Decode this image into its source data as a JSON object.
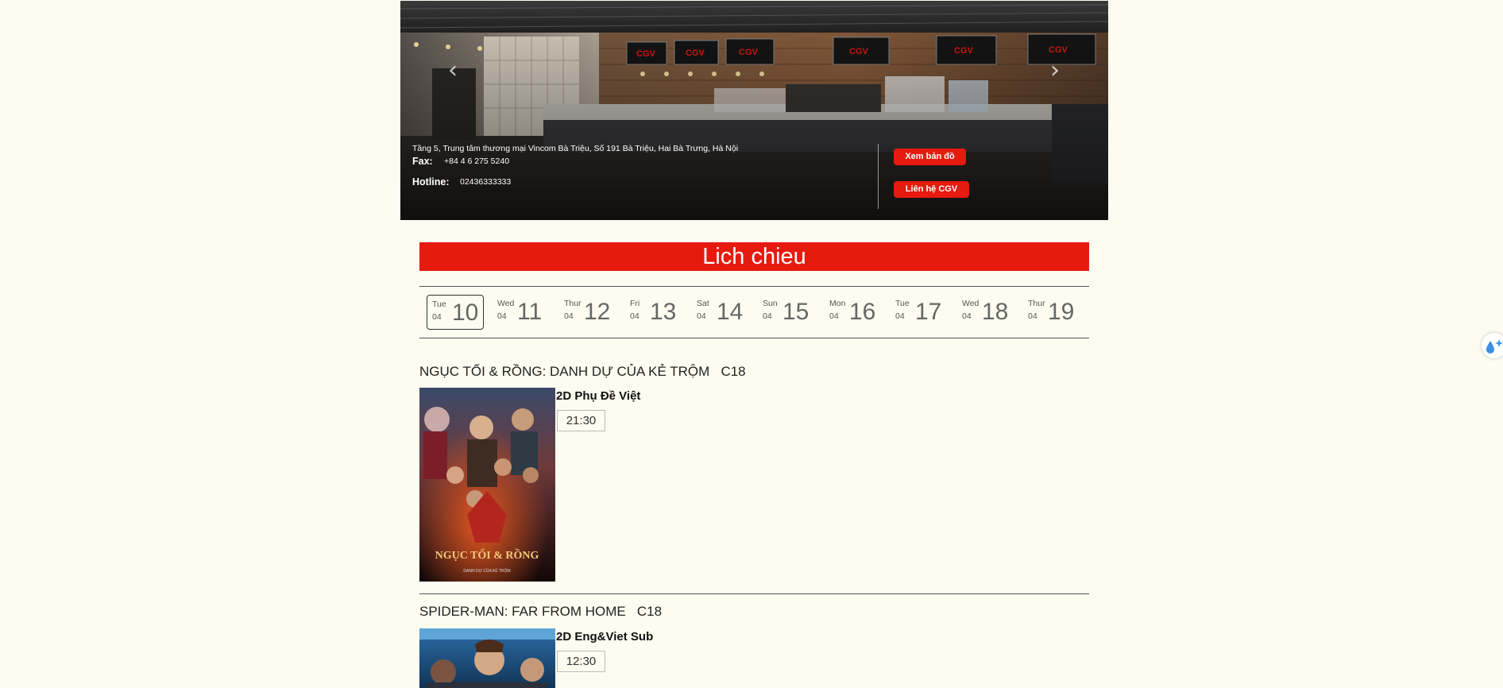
{
  "banner": {
    "address": "Tầng 5, Trung tâm thương mại Vincom Bà Triệu, Số 191 Bà Triệu, Hai Bà Trưng, Hà Nội",
    "fax_label": "Fax:",
    "fax_value": "+84 4 6 275 5240",
    "hotline_label": "Hotline:",
    "hotline_value": "02436333333",
    "map_button": "Xem bản đồ",
    "contact_button": "Liên hệ CGV",
    "prev_icon": "chevron-left-icon",
    "next_icon": "chevron-right-icon",
    "accent": "#e71a0f"
  },
  "schedule_title": "Lich chieu",
  "dates": [
    {
      "weekday": "Tue",
      "month": "04",
      "day": "10",
      "active": true
    },
    {
      "weekday": "Wed",
      "month": "04",
      "day": "11"
    },
    {
      "weekday": "Thur",
      "month": "04",
      "day": "12"
    },
    {
      "weekday": "Fri",
      "month": "04",
      "day": "13"
    },
    {
      "weekday": "Sat",
      "month": "04",
      "day": "14"
    },
    {
      "weekday": "Sun",
      "month": "04",
      "day": "15"
    },
    {
      "weekday": "Mon",
      "month": "04",
      "day": "16"
    },
    {
      "weekday": "Tue",
      "month": "04",
      "day": "17"
    },
    {
      "weekday": "Wed",
      "month": "04",
      "day": "18"
    },
    {
      "weekday": "Thur",
      "month": "04",
      "day": "19"
    }
  ],
  "movies": [
    {
      "title": "NGỤC TỐI & RỒNG: DANH DỰ CỦA KẺ TRỘM",
      "rating": "C18",
      "format": "2D Phụ Đề Việt",
      "times": [
        "21:30"
      ],
      "poster_text": "NGỤC TỐI & RỒNG"
    },
    {
      "title": "SPIDER-MAN: FAR FROM HOME",
      "rating": "C18",
      "format": "2D Eng&Viet Sub",
      "times": [
        "12:30"
      ]
    }
  ]
}
